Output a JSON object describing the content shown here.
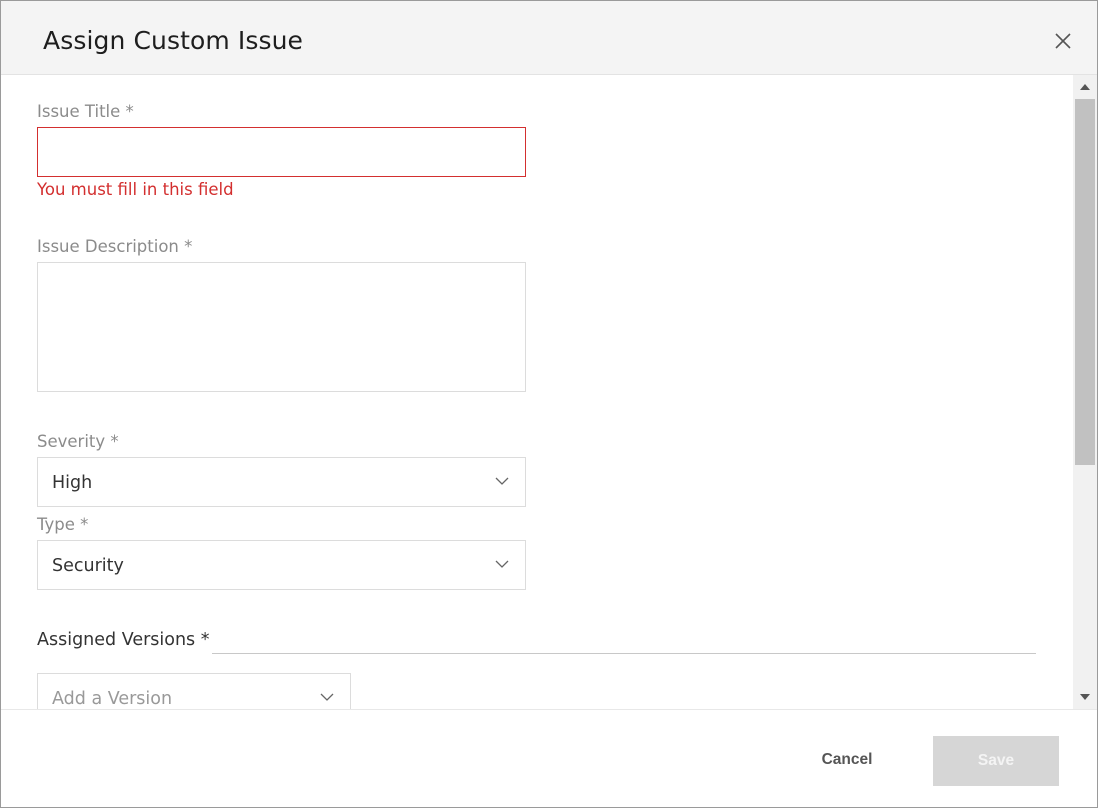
{
  "dialog": {
    "title": "Assign Custom Issue"
  },
  "form": {
    "issue_title": {
      "label": "Issue Title *",
      "value": "",
      "error": "You must fill in this field"
    },
    "issue_description": {
      "label": "Issue Description *",
      "value": ""
    },
    "severity": {
      "label": "Severity *",
      "value": "High"
    },
    "type": {
      "label": "Type *",
      "value": "Security"
    },
    "assigned_versions": {
      "label": "Assigned Versions *",
      "placeholder": "Add a Version"
    }
  },
  "footer": {
    "cancel_label": "Cancel",
    "save_label": "Save"
  },
  "icons": {
    "close": "close-icon",
    "dropdown": "chevron-down-icon",
    "scroll_up": "arrow-up-icon",
    "scroll_down": "arrow-down-icon"
  },
  "colors": {
    "error": "#d32f2f",
    "header_bg": "#f4f4f4",
    "save_disabled_bg": "#d6d6d6"
  }
}
